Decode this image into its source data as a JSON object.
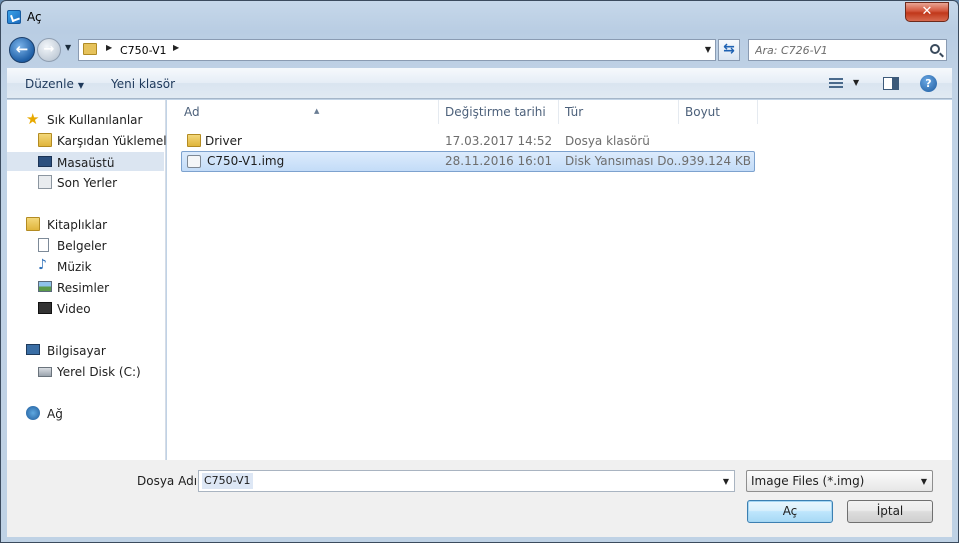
{
  "window": {
    "title": "Aç",
    "close_label": "✕"
  },
  "address": {
    "crumbs": [
      "C750-V1"
    ],
    "search_placeholder": "Ara: C726-V1"
  },
  "toolbar": {
    "organize_label": "Düzenle",
    "new_folder_label": "Yeni klasör"
  },
  "nav": {
    "favorites_label": "Sık Kullanılanlar",
    "items": [
      {
        "label": "Karşıdan Yüklemeler",
        "icon": "downloads-icon"
      },
      {
        "label": "Masaüstü",
        "icon": "desktop-icon",
        "selected": true
      },
      {
        "label": "Son Yerler",
        "icon": "recent-places-icon"
      }
    ],
    "libraries_label": "Kitaplıklar",
    "libraries": [
      {
        "label": "Belgeler",
        "icon": "documents-icon"
      },
      {
        "label": "Müzik",
        "icon": "music-icon"
      },
      {
        "label": "Resimler",
        "icon": "pictures-icon"
      },
      {
        "label": "Video",
        "icon": "video-icon"
      }
    ],
    "computer_label": "Bilgisayar",
    "computer_items": [
      {
        "label": "Yerel Disk (C:)",
        "icon": "local-disk-icon"
      }
    ],
    "network_label": "Ağ"
  },
  "columns": {
    "name": "Ad",
    "modified": "Değiştirme tarihi",
    "type": "Tür",
    "size": "Boyut"
  },
  "files": [
    {
      "name": "Driver",
      "modified": "17.03.2017 14:52",
      "type": "Dosya klasörü",
      "size": "",
      "icon": "folder-icon",
      "selected": false
    },
    {
      "name": "C750-V1.img",
      "modified": "28.11.2016 16:01",
      "type": "Disk Yansıması Do...",
      "size": "939.124 KB",
      "icon": "disk-image-icon",
      "selected": true
    }
  ],
  "bottom": {
    "filename_label": "Dosya Adı:",
    "filename_value": "C750-V1",
    "filetype_value": "Image Files (*.img)",
    "open_label": "Aç",
    "cancel_label": "İptal"
  }
}
